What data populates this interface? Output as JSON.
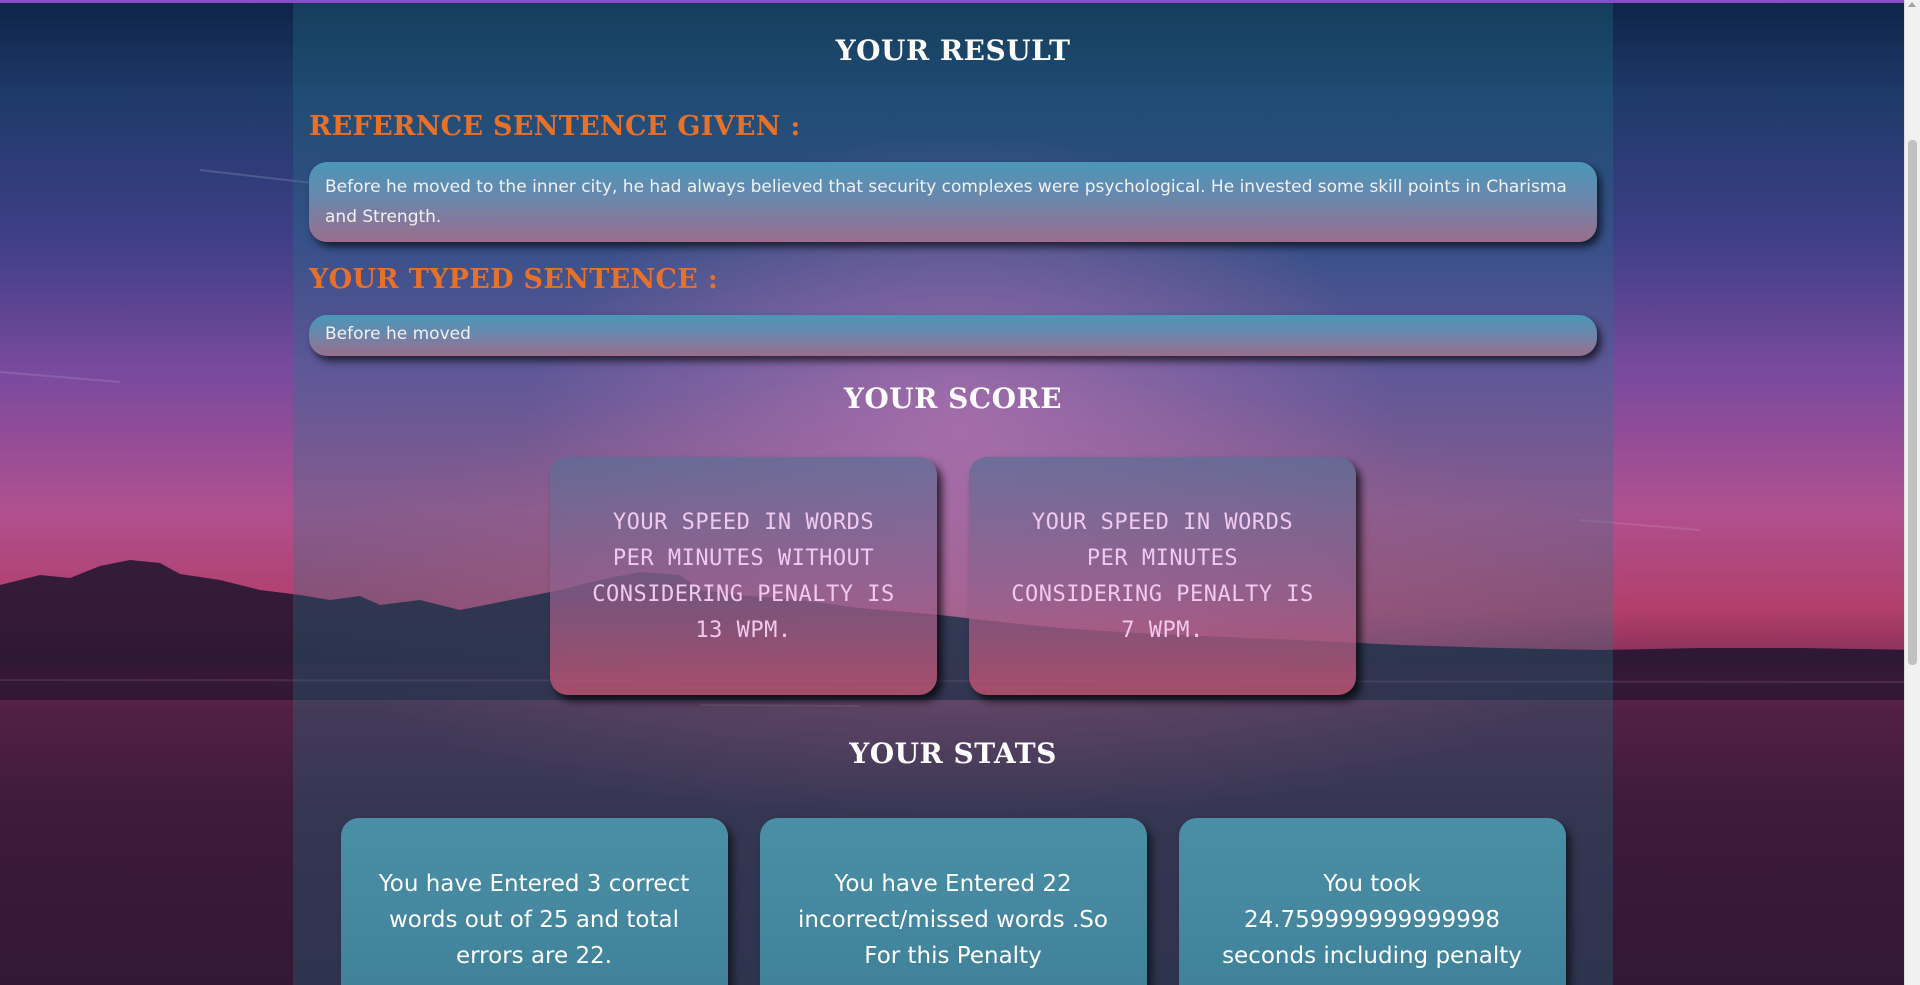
{
  "page": {
    "result_heading": "YOUR RESULT",
    "reference_label": "REFERNCE SENTENCE GIVEN :",
    "reference_sentence": "Before he moved to the inner city, he had always believed that security complexes were psychological. He invested some skill points in Charisma and Strength.",
    "typed_label": "YOUR TYPED SENTENCE :",
    "typed_sentence": "Before he moved",
    "score_heading": "YOUR SCORE",
    "stats_heading": "YOUR STATS"
  },
  "score_cards": [
    {
      "text": "YOUR SPEED IN WORDS PER MINUTES WITHOUT CONSIDERING PENALTY IS 13 WPM."
    },
    {
      "text": "YOUR SPEED IN WORDS PER MINUTES CONSIDERING PENALTY IS 7 WPM."
    }
  ],
  "stat_cards": [
    {
      "text": "You have Entered 3 correct words out of 25 and total errors are 22."
    },
    {
      "text": "You have Entered 22 incorrect/missed words .So For this Penalty"
    },
    {
      "text": "You took 24.759999999999998 seconds including penalty"
    }
  ],
  "colors": {
    "accent_label": "#e8712a",
    "heading": "#ffffff",
    "score_text": "#f2c9ee",
    "top_line": "#8a4cc7"
  }
}
